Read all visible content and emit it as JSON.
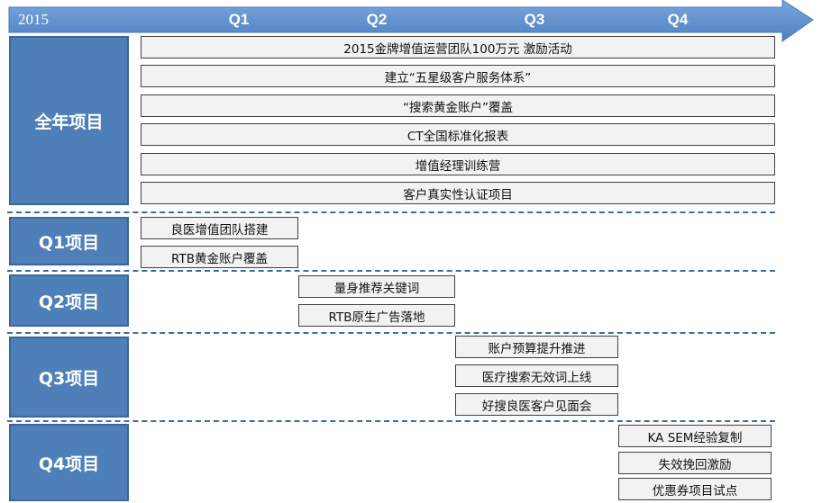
{
  "timeline": {
    "year": "2015",
    "quarters": [
      "Q1",
      "Q2",
      "Q3",
      "Q4"
    ]
  },
  "colors": {
    "arrow": "#5b8fd0",
    "section_fill": "#4f7fb8",
    "task_fill": "#f2f2f2",
    "divider": "#3a6ea8"
  },
  "sections": [
    {
      "label": "全年项目",
      "tasks": [
        "2015金牌增值运营团队100万元 激励活动",
        "建立“五星级客户服务体系”",
        "“搜索黄金账户”覆盖",
        "CT全国标准化报表",
        "增值经理训练营",
        "客户真实性认证项目"
      ]
    },
    {
      "label": "Q1项目",
      "tasks": [
        "良医增值团队搭建",
        "RTB黄金账户覆盖"
      ]
    },
    {
      "label": "Q2项目",
      "tasks": [
        "量身推荐关键词",
        "RTB原生广告落地"
      ]
    },
    {
      "label": "Q3项目",
      "tasks": [
        "账户预算提升推进",
        "医疗搜索无效词上线",
        "好搜良医客户见面会"
      ]
    },
    {
      "label": "Q4项目",
      "tasks": [
        "KA SEM经验复制",
        "失效挽回激励",
        "优惠券项目试点"
      ]
    }
  ]
}
